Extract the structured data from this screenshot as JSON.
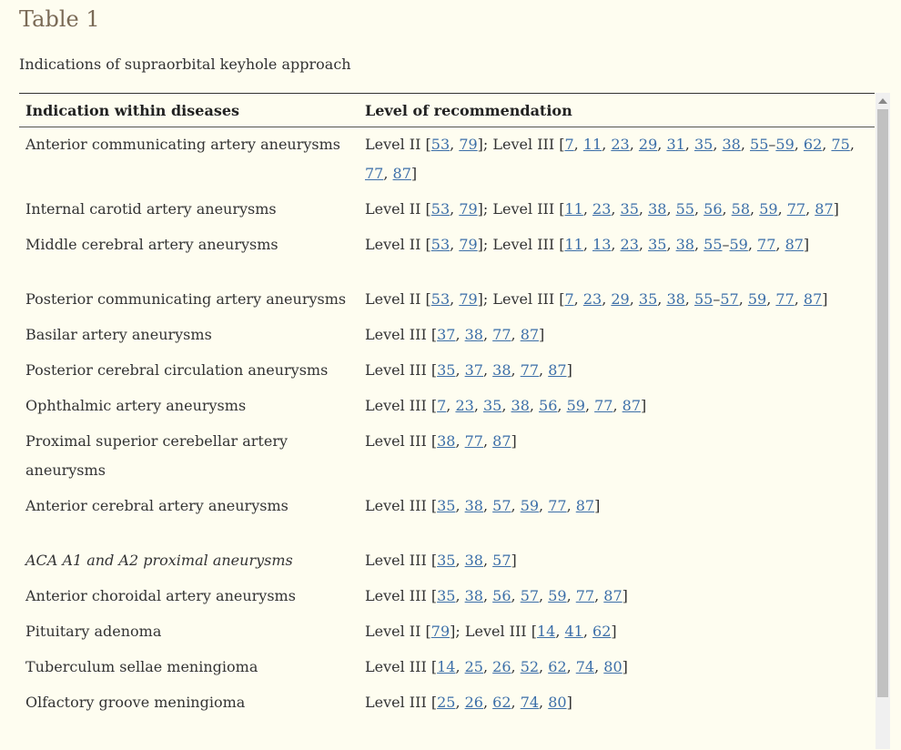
{
  "title": "Table 1",
  "caption": "Indications of supraorbital keyhole approach",
  "headers": [
    "Indication within diseases",
    "Level of recommendation"
  ],
  "rows": [
    {
      "disease": "Anterior communicating artery aneurysms",
      "italic": false,
      "gap": false,
      "parts": [
        {
          "t": "Level II ["
        },
        {
          "r": "53"
        },
        {
          "t": ", "
        },
        {
          "r": "79"
        },
        {
          "t": "]; Level III ["
        },
        {
          "r": "7"
        },
        {
          "t": ", "
        },
        {
          "r": "11"
        },
        {
          "t": ", "
        },
        {
          "r": "23"
        },
        {
          "t": ", "
        },
        {
          "r": "29"
        },
        {
          "t": ", "
        },
        {
          "r": "31"
        },
        {
          "t": ", "
        },
        {
          "r": "35"
        },
        {
          "t": ", "
        },
        {
          "r": "38"
        },
        {
          "t": ", "
        },
        {
          "r": "55"
        },
        {
          "t": "–"
        },
        {
          "r": "59"
        },
        {
          "t": ", "
        },
        {
          "r": "62"
        },
        {
          "t": ", "
        },
        {
          "r": "75"
        },
        {
          "t": ", "
        },
        {
          "r": "77"
        },
        {
          "t": ", "
        },
        {
          "r": "87"
        },
        {
          "t": "]"
        }
      ]
    },
    {
      "disease": "Internal carotid artery aneurysms",
      "italic": false,
      "gap": false,
      "parts": [
        {
          "t": "Level II ["
        },
        {
          "r": "53"
        },
        {
          "t": ", "
        },
        {
          "r": "79"
        },
        {
          "t": "]; Level III ["
        },
        {
          "r": "11"
        },
        {
          "t": ", "
        },
        {
          "r": "23"
        },
        {
          "t": ", "
        },
        {
          "r": "35"
        },
        {
          "t": ", "
        },
        {
          "r": "38"
        },
        {
          "t": ", "
        },
        {
          "r": "55"
        },
        {
          "t": ", "
        },
        {
          "r": "56"
        },
        {
          "t": ", "
        },
        {
          "r": "58"
        },
        {
          "t": ", "
        },
        {
          "r": "59"
        },
        {
          "t": ", "
        },
        {
          "r": "77"
        },
        {
          "t": ", "
        },
        {
          "r": "87"
        },
        {
          "t": "]"
        }
      ]
    },
    {
      "disease": "Middle cerebral artery aneurysms",
      "italic": false,
      "gap": true,
      "parts": [
        {
          "t": "Level II ["
        },
        {
          "r": "53"
        },
        {
          "t": ", "
        },
        {
          "r": "79"
        },
        {
          "t": "]; Level III ["
        },
        {
          "r": "11"
        },
        {
          "t": ", "
        },
        {
          "r": "13"
        },
        {
          "t": ", "
        },
        {
          "r": "23"
        },
        {
          "t": ", "
        },
        {
          "r": "35"
        },
        {
          "t": ", "
        },
        {
          "r": "38"
        },
        {
          "t": ", "
        },
        {
          "r": "55"
        },
        {
          "t": "–"
        },
        {
          "r": "59"
        },
        {
          "t": ", "
        },
        {
          "r": "77"
        },
        {
          "t": ", "
        },
        {
          "r": "87"
        },
        {
          "t": "]"
        }
      ]
    },
    {
      "disease": "Posterior communicating artery aneurysms",
      "italic": false,
      "gap": false,
      "parts": [
        {
          "t": "Level II ["
        },
        {
          "r": "53"
        },
        {
          "t": ", "
        },
        {
          "r": "79"
        },
        {
          "t": "]; Level III ["
        },
        {
          "r": "7"
        },
        {
          "t": ", "
        },
        {
          "r": "23"
        },
        {
          "t": ", "
        },
        {
          "r": "29"
        },
        {
          "t": ", "
        },
        {
          "r": "35"
        },
        {
          "t": ", "
        },
        {
          "r": "38"
        },
        {
          "t": ", "
        },
        {
          "r": "55"
        },
        {
          "t": "–"
        },
        {
          "r": "57"
        },
        {
          "t": ", "
        },
        {
          "r": "59"
        },
        {
          "t": ", "
        },
        {
          "r": "77"
        },
        {
          "t": ", "
        },
        {
          "r": "87"
        },
        {
          "t": "]"
        }
      ]
    },
    {
      "disease": "Basilar artery aneurysms",
      "italic": false,
      "gap": false,
      "parts": [
        {
          "t": "Level III ["
        },
        {
          "r": "37"
        },
        {
          "t": ", "
        },
        {
          "r": "38"
        },
        {
          "t": ", "
        },
        {
          "r": "77"
        },
        {
          "t": ", "
        },
        {
          "r": "87"
        },
        {
          "t": "]"
        }
      ]
    },
    {
      "disease": "Posterior cerebral circulation aneurysms",
      "italic": false,
      "gap": false,
      "parts": [
        {
          "t": "Level III ["
        },
        {
          "r": "35"
        },
        {
          "t": ", "
        },
        {
          "r": "37"
        },
        {
          "t": ", "
        },
        {
          "r": "38"
        },
        {
          "t": ", "
        },
        {
          "r": "77"
        },
        {
          "t": ", "
        },
        {
          "r": "87"
        },
        {
          "t": "]"
        }
      ]
    },
    {
      "disease": "Ophthalmic artery aneurysms",
      "italic": false,
      "gap": false,
      "parts": [
        {
          "t": "Level III ["
        },
        {
          "r": "7"
        },
        {
          "t": ", "
        },
        {
          "r": "23"
        },
        {
          "t": ", "
        },
        {
          "r": "35"
        },
        {
          "t": ", "
        },
        {
          "r": "38"
        },
        {
          "t": ", "
        },
        {
          "r": "56"
        },
        {
          "t": ", "
        },
        {
          "r": "59"
        },
        {
          "t": ", "
        },
        {
          "r": "77"
        },
        {
          "t": ", "
        },
        {
          "r": "87"
        },
        {
          "t": "]"
        }
      ]
    },
    {
      "disease": "Proximal superior cerebellar artery aneurysms",
      "italic": false,
      "gap": false,
      "parts": [
        {
          "t": "Level III ["
        },
        {
          "r": "38"
        },
        {
          "t": ", "
        },
        {
          "r": "77"
        },
        {
          "t": ", "
        },
        {
          "r": "87"
        },
        {
          "t": "]"
        }
      ]
    },
    {
      "disease": "Anterior cerebral artery aneurysms",
      "italic": false,
      "gap": true,
      "parts": [
        {
          "t": "Level III ["
        },
        {
          "r": "35"
        },
        {
          "t": ", "
        },
        {
          "r": "38"
        },
        {
          "t": ", "
        },
        {
          "r": "57"
        },
        {
          "t": ", "
        },
        {
          "r": "59"
        },
        {
          "t": ", "
        },
        {
          "r": "77"
        },
        {
          "t": ", "
        },
        {
          "r": "87"
        },
        {
          "t": "]"
        }
      ]
    },
    {
      "disease": "ACA A1 and A2 proximal aneurysms",
      "italic": true,
      "gap": false,
      "parts": [
        {
          "t": "Level III ["
        },
        {
          "r": "35"
        },
        {
          "t": ", "
        },
        {
          "r": "38"
        },
        {
          "t": ", "
        },
        {
          "r": "57"
        },
        {
          "t": "]"
        }
      ]
    },
    {
      "disease": "Anterior choroidal artery aneurysms",
      "italic": false,
      "gap": false,
      "parts": [
        {
          "t": "Level III ["
        },
        {
          "r": "35"
        },
        {
          "t": ", "
        },
        {
          "r": "38"
        },
        {
          "t": ", "
        },
        {
          "r": "56"
        },
        {
          "t": ", "
        },
        {
          "r": "57"
        },
        {
          "t": ", "
        },
        {
          "r": "59"
        },
        {
          "t": ", "
        },
        {
          "r": "77"
        },
        {
          "t": ", "
        },
        {
          "r": "87"
        },
        {
          "t": "]"
        }
      ]
    },
    {
      "disease": "Pituitary adenoma",
      "italic": false,
      "gap": false,
      "parts": [
        {
          "t": "Level II ["
        },
        {
          "r": "79"
        },
        {
          "t": "]; Level III ["
        },
        {
          "r": "14"
        },
        {
          "t": ", "
        },
        {
          "r": "41"
        },
        {
          "t": ", "
        },
        {
          "r": "62"
        },
        {
          "t": "]"
        }
      ]
    },
    {
      "disease": "Tuberculum sellae meningioma",
      "italic": false,
      "gap": false,
      "parts": [
        {
          "t": "Level III ["
        },
        {
          "r": "14"
        },
        {
          "t": ", "
        },
        {
          "r": "25"
        },
        {
          "t": ", "
        },
        {
          "r": "26"
        },
        {
          "t": ", "
        },
        {
          "r": "52"
        },
        {
          "t": ", "
        },
        {
          "r": "62"
        },
        {
          "t": ", "
        },
        {
          "r": "74"
        },
        {
          "t": ", "
        },
        {
          "r": "80"
        },
        {
          "t": "]"
        }
      ]
    },
    {
      "disease": "Olfactory groove meningioma",
      "italic": false,
      "gap": false,
      "parts": [
        {
          "t": "Level III ["
        },
        {
          "r": "25"
        },
        {
          "t": ", "
        },
        {
          "r": "26"
        },
        {
          "t": ", "
        },
        {
          "r": "62"
        },
        {
          "t": ", "
        },
        {
          "r": "74"
        },
        {
          "t": ", "
        },
        {
          "r": "80"
        },
        {
          "t": "]"
        }
      ]
    }
  ],
  "colors": {
    "background": "#fefdf0",
    "title": "#7a6a56",
    "link": "#3b6ea8"
  }
}
